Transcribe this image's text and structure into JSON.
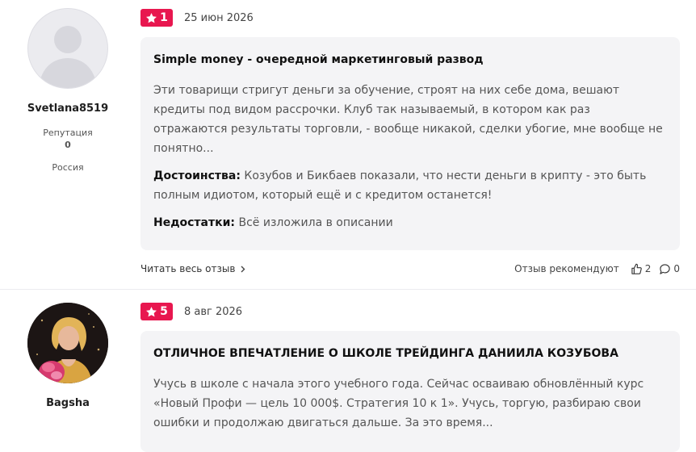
{
  "reviews": [
    {
      "user": {
        "name": "Svetlana8519",
        "reputation_label": "Репутация",
        "reputation": "0",
        "country": "Россия"
      },
      "rating": "1",
      "date": "25 июн 2026",
      "title": "Simple money - очередной маркетинговый развод",
      "text": "Эти товарищи стригут деньги за обучение, строят на них себе дома, вешают кредиты под видом рассрочки. Клуб так называемый, в котором как раз отражаются результаты торговли, - вообще никакой, сделки убогие, мне вообще не понятно...",
      "pros_label": "Достоинства:",
      "pros": "Козубов и Бикбаев показали, что нести деньги в крипту - это быть полным идиотом, который ещё и с кредитом останется!",
      "cons_label": "Недостатки:",
      "cons": "Всё изложила в описании",
      "read_more": "Читать весь отзыв",
      "recommend_label": "Отзыв рекомендуют",
      "likes": "2",
      "comments": "0"
    },
    {
      "user": {
        "name": "Bagsha"
      },
      "rating": "5",
      "date": "8 авг 2026",
      "title": "ОТЛИЧНОЕ ВПЕЧАТЛЕНИЕ О ШКОЛЕ ТРЕЙДИНГА ДАНИИЛА КОЗУБОВА",
      "text": "Учусь в школе с начала этого учебного года. Сейчас осваиваю обновлённый курс «Новый Профи — цель 10 000$. Стратегия 10 к 1». Учусь, торгую, разбираю свои ошибки и продолжаю двигаться дальше. За это время..."
    }
  ],
  "colors": {
    "accent": "#e8174f",
    "card_bg": "#f4f4f6"
  },
  "icons": {
    "rating": "star-icon",
    "read_more": "chevron-right-icon",
    "likes": "thumbs-up-icon",
    "comments": "comment-icon"
  }
}
